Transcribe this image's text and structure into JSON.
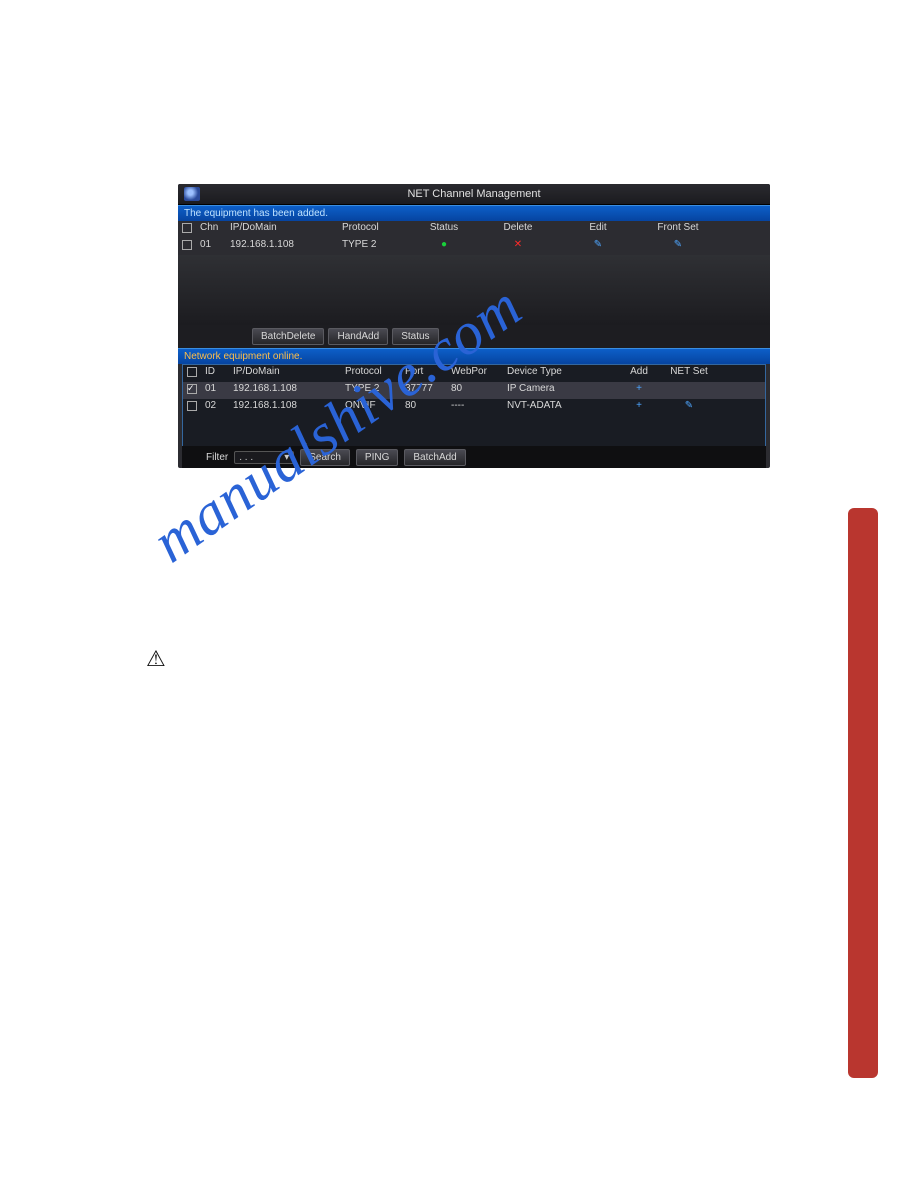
{
  "watermark_text": "manualshive.com",
  "screenshot": {
    "title": "NET Channel Management",
    "status_bar": "The equipment has been added.",
    "upper_headers": {
      "chn": "Chn",
      "ip": "IP/DoMain",
      "protocol": "Protocol",
      "status": "Status",
      "delete": "Delete",
      "edit": "Edit",
      "front": "Front Set"
    },
    "upper_rows": [
      {
        "chn": "01",
        "ip": "192.168.1.108",
        "protocol": "TYPE 2",
        "status": "●",
        "delete": "✕",
        "edit": "✎",
        "front": "✎"
      }
    ],
    "tabs": {
      "batch_delete": "BatchDelete",
      "hand_add": "HandAdd",
      "status": "Status"
    },
    "lower_title": "Network equipment online.",
    "lower_headers": {
      "id": "ID",
      "ip": "IP/DoMain",
      "protocol": "Protocol",
      "port": "Port",
      "webpor": "WebPor",
      "type": "Device Type",
      "add": "Add",
      "netset": "NET Set"
    },
    "lower_rows": [
      {
        "checked": true,
        "id": "01",
        "ip": "192.168.1.108",
        "protocol": "TYPE 2",
        "port": "37777",
        "web": "80",
        "type": "IP Camera",
        "add": "+",
        "net": ""
      },
      {
        "checked": false,
        "id": "02",
        "ip": "192.168.1.108",
        "protocol": "ONVIF",
        "port": "80",
        "web": "----",
        "type": "NVT-ADATA",
        "add": "+",
        "net": "✎"
      }
    ],
    "footer": {
      "filter_label": "Filter",
      "filter_value": ". . .",
      "search": "Search",
      "ping": "PING",
      "batch_add": "BatchAdd"
    }
  }
}
